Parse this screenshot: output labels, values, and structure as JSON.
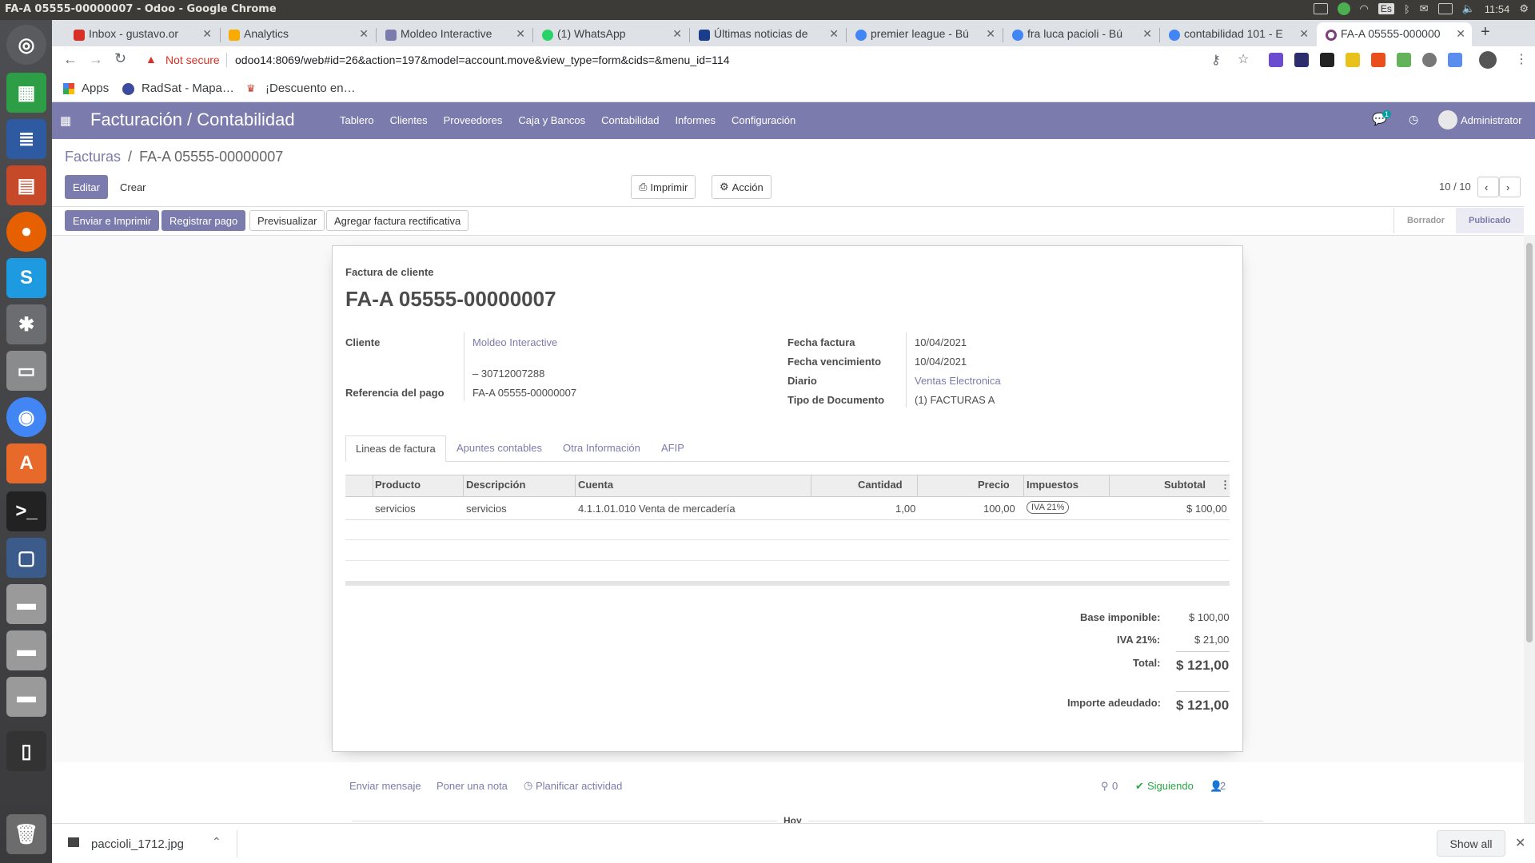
{
  "os": {
    "window_title": "FA-A 05555-00000007 - Odoo - Google Chrome",
    "lang": "Es",
    "clock": "11:54"
  },
  "browser": {
    "tabs": [
      {
        "label": "Inbox - gustavo.or",
        "color": "#d93025"
      },
      {
        "label": "Analytics",
        "color": "#f9ab00"
      },
      {
        "label": "Moldeo Interactive",
        "color": "#7c7bad"
      },
      {
        "label": "(1) WhatsApp",
        "color": "#25d366"
      },
      {
        "label": "Últimas noticias de",
        "color": "#1a3e8c"
      },
      {
        "label": "premier league - Bú",
        "color": "#4285f4"
      },
      {
        "label": "fra luca pacioli - Bú",
        "color": "#4285f4"
      },
      {
        "label": "contabilidad 101 - E",
        "color": "#4285f4"
      },
      {
        "label": "FA-A 05555-000000",
        "color": "#7b3f7b"
      }
    ],
    "not_secure": "Not secure",
    "url": "odoo14:8069/web#id=26&action=197&model=account.move&view_type=form&cids=&menu_id=114",
    "bookmarks": [
      "Apps",
      "RadSat - Mapa…",
      "¡Descuento en…"
    ]
  },
  "odoo": {
    "app_title": "Facturación / Contabilidad",
    "menu": [
      "Tablero",
      "Clientes",
      "Proveedores",
      "Caja y Bancos",
      "Contabilidad",
      "Informes",
      "Configuración"
    ],
    "chat_count": "1",
    "user": "Administrator",
    "breadcrumb_parent": "Facturas",
    "breadcrumb_sep": "/",
    "breadcrumb_current": "FA-A 05555-00000007",
    "btn_edit": "Editar",
    "btn_create": "Crear",
    "btn_print": "Imprimir",
    "btn_action": "Acción",
    "pager": "10 / 10",
    "actions": [
      "Enviar e Imprimir",
      "Registrar pago",
      "Previsualizar",
      "Agregar factura rectificativa"
    ],
    "status_draft": "Borrador",
    "status_posted": "Publicado"
  },
  "invoice": {
    "type_label": "Factura de cliente",
    "number": "FA-A 05555-00000007",
    "cliente_label": "Cliente",
    "cliente": "Moldeo Interactive",
    "cliente_cuit": "– 30712007288",
    "ref_label": "Referencia del pago",
    "ref": "FA-A 05555-00000007",
    "fecha_label": "Fecha factura",
    "fecha": "10/04/2021",
    "venc_label": "Fecha vencimiento",
    "venc": "10/04/2021",
    "diario_label": "Diario",
    "diario": "Ventas Electronica",
    "tipo_label": "Tipo de Documento",
    "tipo": "(1) FACTURAS A",
    "tabs": [
      "Lineas de factura",
      "Apuntes contables",
      "Otra Información",
      "AFIP"
    ],
    "columns": {
      "producto": "Producto",
      "descripcion": "Descripción",
      "cuenta": "Cuenta",
      "cantidad": "Cantidad",
      "precio": "Precio",
      "impuestos": "Impuestos",
      "subtotal": "Subtotal"
    },
    "line": {
      "producto": "servicios",
      "descripcion": "servicios",
      "cuenta": "4.1.1.01.010 Venta de mercadería",
      "cantidad": "1,00",
      "precio": "100,00",
      "impuesto": "IVA 21%",
      "subtotal": "$ 100,00"
    },
    "base_label": "Base imponible:",
    "base": "$ 100,00",
    "iva_label": "IVA 21%:",
    "iva": "$ 21,00",
    "total_label": "Total:",
    "total": "$ 121,00",
    "adeudado_label": "Importe adeudado:",
    "adeudado": "$ 121,00"
  },
  "chatter": {
    "send": "Enviar mensaje",
    "note": "Poner una nota",
    "activity": "Planificar actividad",
    "attachments": "0",
    "following": "Siguiendo",
    "followers": "2",
    "today": "Hoy"
  },
  "downloads": {
    "file": "paccioli_1712.jpg",
    "show_all": "Show all"
  }
}
